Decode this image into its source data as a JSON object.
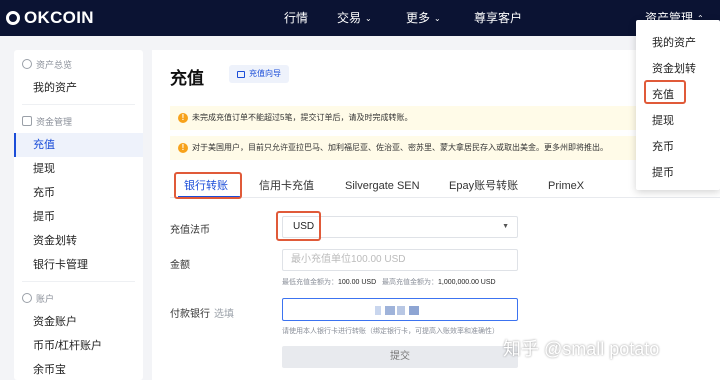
{
  "brand": {
    "name": "OKCOIN"
  },
  "nav": {
    "items": [
      {
        "label": "行情"
      },
      {
        "label": "交易"
      },
      {
        "label": "更多"
      },
      {
        "label": "尊享客户"
      },
      {
        "label": "资产管理"
      }
    ]
  },
  "sidebar": {
    "overview_section": "资产总览",
    "overview_items": [
      {
        "label": "我的资产"
      }
    ],
    "funds_section": "资金管理",
    "funds_items": [
      {
        "label": "充值"
      },
      {
        "label": "提现"
      },
      {
        "label": "充币"
      },
      {
        "label": "提币"
      },
      {
        "label": "资金划转"
      },
      {
        "label": "银行卡管理"
      }
    ],
    "account_section": "账户",
    "account_items": [
      {
        "label": "资金账户"
      },
      {
        "label": "币币/杠杆账户"
      },
      {
        "label": "余币宝"
      }
    ]
  },
  "main": {
    "title": "充值",
    "guide_button": "充值向导",
    "notices": [
      "未完成充值订单不能超过5笔，提交订单后，请及时完成转账。",
      "对于美国用户，目前只允许亚拉巴马、加利福尼亚、佐治亚、密苏里、蒙大拿居民存入或取出美金。更多州即将推出。"
    ],
    "tabs": [
      {
        "label": "银行转账"
      },
      {
        "label": "信用卡充值"
      },
      {
        "label": "Silvergate SEN"
      },
      {
        "label": "Epay账号转账"
      },
      {
        "label": "PrimeX"
      }
    ],
    "form": {
      "currency_label": "充值法币",
      "currency_value": "USD",
      "amount_label": "金额",
      "amount_placeholder": "最小充值单位100.00 USD",
      "min_label": "最低充值金额为：",
      "min_value": "100.00 USD",
      "max_label": "最高充值金额为：",
      "max_value": "1,000,000.00 USD",
      "bank_label": "付款银行",
      "bank_optional": "选填",
      "bank_hint": "请使用本人银行卡进行转账（绑定银行卡，可提高入账效率和准确性）",
      "submit_label": "提交"
    }
  },
  "dropdown": {
    "items": [
      {
        "label": "我的资产"
      },
      {
        "label": "资金划转"
      },
      {
        "label": "充值"
      },
      {
        "label": "提现"
      },
      {
        "label": "充币"
      },
      {
        "label": "提币"
      }
    ]
  },
  "watermark": "知乎 @small potato",
  "colors": {
    "topbar": "#0b1333",
    "accent": "#1b4dd8",
    "highlight": "#e05a39",
    "notice_bg": "#fffbe8"
  }
}
